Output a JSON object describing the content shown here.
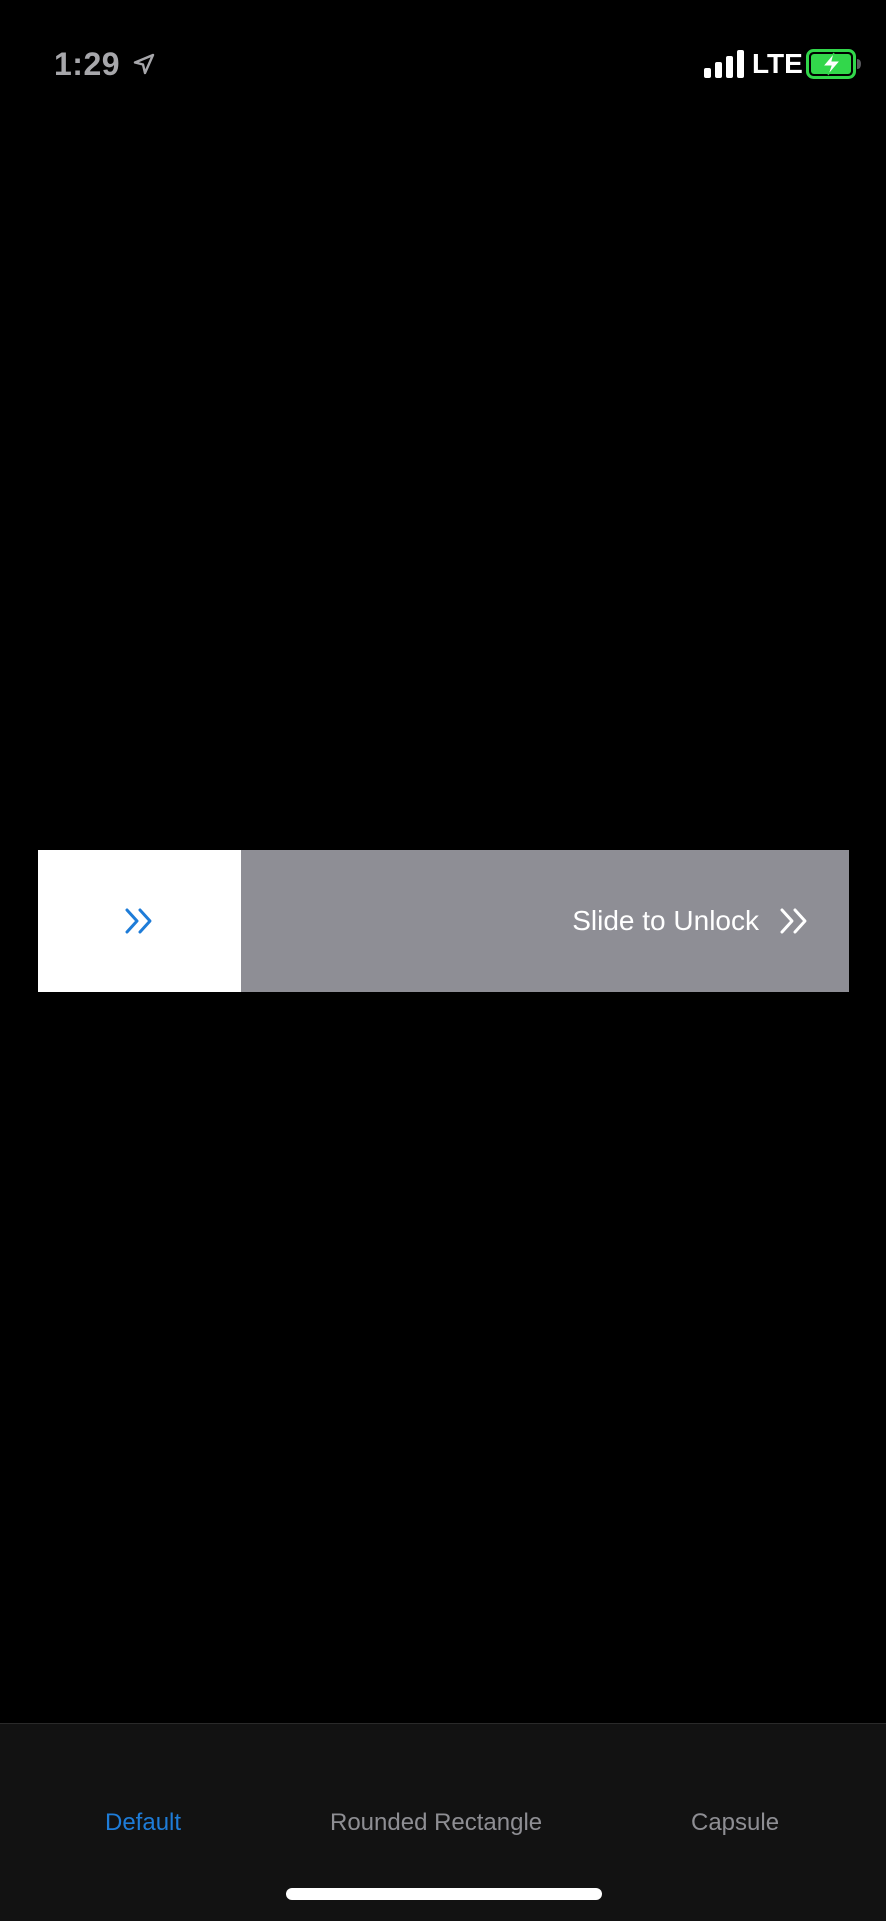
{
  "status_bar": {
    "time": "1:29",
    "network": "LTE",
    "location_icon": "location-arrow-icon",
    "signal_icon": "cellular-signal-icon",
    "battery_icon": "battery-charging-icon",
    "battery_color": "#32d74b"
  },
  "slider": {
    "label": "Slide to Unlock",
    "thumb_icon": "double-chevron-right-icon",
    "text_icon": "double-chevron-right-icon",
    "track_color": "#8e8e95",
    "thumb_color": "#ffffff",
    "accent_color": "#1e7cd8",
    "progress": 0
  },
  "tab_bar": {
    "tabs": [
      {
        "label": "Default",
        "active": true
      },
      {
        "label": "Rounded Rectangle",
        "active": false
      },
      {
        "label": "Capsule",
        "active": false
      }
    ],
    "active_color": "#1e7cd8",
    "inactive_color": "#8e8e93"
  }
}
